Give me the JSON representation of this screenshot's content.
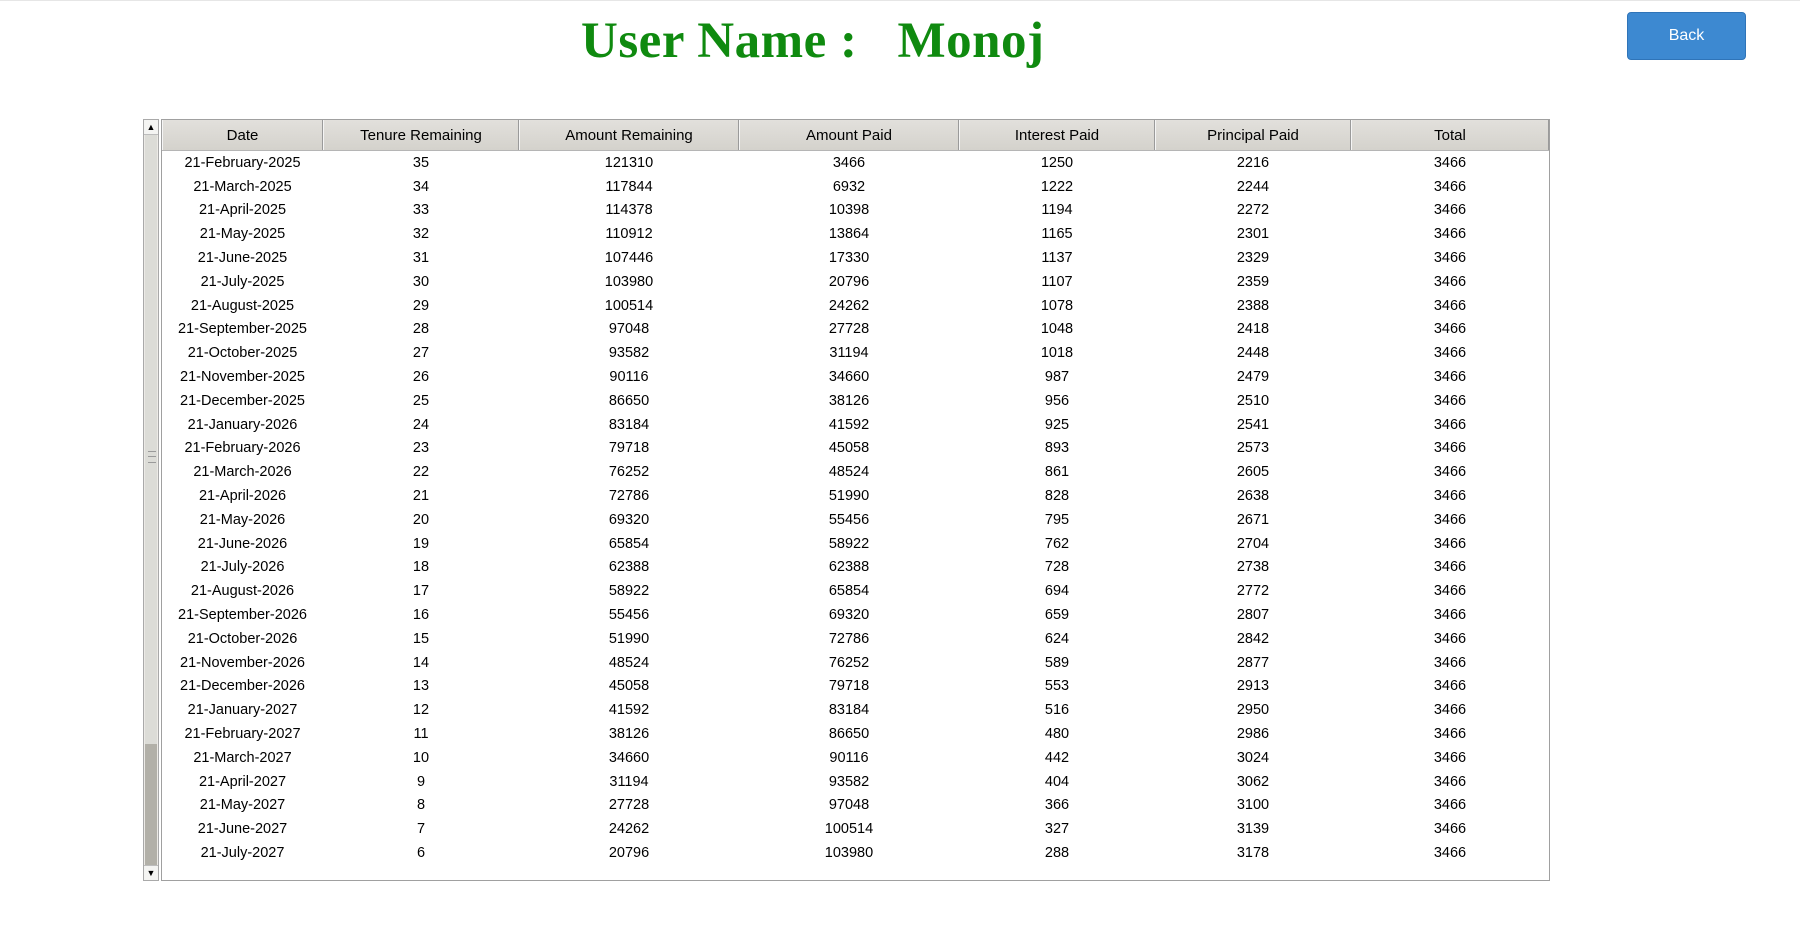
{
  "header": {
    "user_label": "User Name :",
    "user_name": "Monoj"
  },
  "buttons": {
    "back": "Back"
  },
  "table": {
    "columns": [
      "Date",
      "Tenure Remaining",
      "Amount Remaining",
      "Amount Paid",
      "Interest Paid",
      "Principal Paid",
      "Total"
    ],
    "rows": [
      [
        "21-February-2025",
        "35",
        "121310",
        "3466",
        "1250",
        "2216",
        "3466"
      ],
      [
        "21-March-2025",
        "34",
        "117844",
        "6932",
        "1222",
        "2244",
        "3466"
      ],
      [
        "21-April-2025",
        "33",
        "114378",
        "10398",
        "1194",
        "2272",
        "3466"
      ],
      [
        "21-May-2025",
        "32",
        "110912",
        "13864",
        "1165",
        "2301",
        "3466"
      ],
      [
        "21-June-2025",
        "31",
        "107446",
        "17330",
        "1137",
        "2329",
        "3466"
      ],
      [
        "21-July-2025",
        "30",
        "103980",
        "20796",
        "1107",
        "2359",
        "3466"
      ],
      [
        "21-August-2025",
        "29",
        "100514",
        "24262",
        "1078",
        "2388",
        "3466"
      ],
      [
        "21-September-2025",
        "28",
        "97048",
        "27728",
        "1048",
        "2418",
        "3466"
      ],
      [
        "21-October-2025",
        "27",
        "93582",
        "31194",
        "1018",
        "2448",
        "3466"
      ],
      [
        "21-November-2025",
        "26",
        "90116",
        "34660",
        "987",
        "2479",
        "3466"
      ],
      [
        "21-December-2025",
        "25",
        "86650",
        "38126",
        "956",
        "2510",
        "3466"
      ],
      [
        "21-January-2026",
        "24",
        "83184",
        "41592",
        "925",
        "2541",
        "3466"
      ],
      [
        "21-February-2026",
        "23",
        "79718",
        "45058",
        "893",
        "2573",
        "3466"
      ],
      [
        "21-March-2026",
        "22",
        "76252",
        "48524",
        "861",
        "2605",
        "3466"
      ],
      [
        "21-April-2026",
        "21",
        "72786",
        "51990",
        "828",
        "2638",
        "3466"
      ],
      [
        "21-May-2026",
        "20",
        "69320",
        "55456",
        "795",
        "2671",
        "3466"
      ],
      [
        "21-June-2026",
        "19",
        "65854",
        "58922",
        "762",
        "2704",
        "3466"
      ],
      [
        "21-July-2026",
        "18",
        "62388",
        "62388",
        "728",
        "2738",
        "3466"
      ],
      [
        "21-August-2026",
        "17",
        "58922",
        "65854",
        "694",
        "2772",
        "3466"
      ],
      [
        "21-September-2026",
        "16",
        "55456",
        "69320",
        "659",
        "2807",
        "3466"
      ],
      [
        "21-October-2026",
        "15",
        "51990",
        "72786",
        "624",
        "2842",
        "3466"
      ],
      [
        "21-November-2026",
        "14",
        "48524",
        "76252",
        "589",
        "2877",
        "3466"
      ],
      [
        "21-December-2026",
        "13",
        "45058",
        "79718",
        "553",
        "2913",
        "3466"
      ],
      [
        "21-January-2027",
        "12",
        "41592",
        "83184",
        "516",
        "2950",
        "3466"
      ],
      [
        "21-February-2027",
        "11",
        "38126",
        "86650",
        "480",
        "2986",
        "3466"
      ],
      [
        "21-March-2027",
        "10",
        "34660",
        "90116",
        "442",
        "3024",
        "3466"
      ],
      [
        "21-April-2027",
        "9",
        "31194",
        "93582",
        "404",
        "3062",
        "3466"
      ],
      [
        "21-May-2027",
        "8",
        "27728",
        "97048",
        "366",
        "3100",
        "3466"
      ],
      [
        "21-June-2027",
        "7",
        "24262",
        "100514",
        "327",
        "3139",
        "3466"
      ],
      [
        "21-July-2027",
        "6",
        "20796",
        "103980",
        "288",
        "3178",
        "3466"
      ]
    ]
  },
  "icons": {
    "scroll_up": "▲",
    "scroll_down": "▼"
  },
  "colors": {
    "title": "#0f8a0f",
    "back_button": "#3d89d1",
    "header_bg": "#d9d7d2"
  }
}
